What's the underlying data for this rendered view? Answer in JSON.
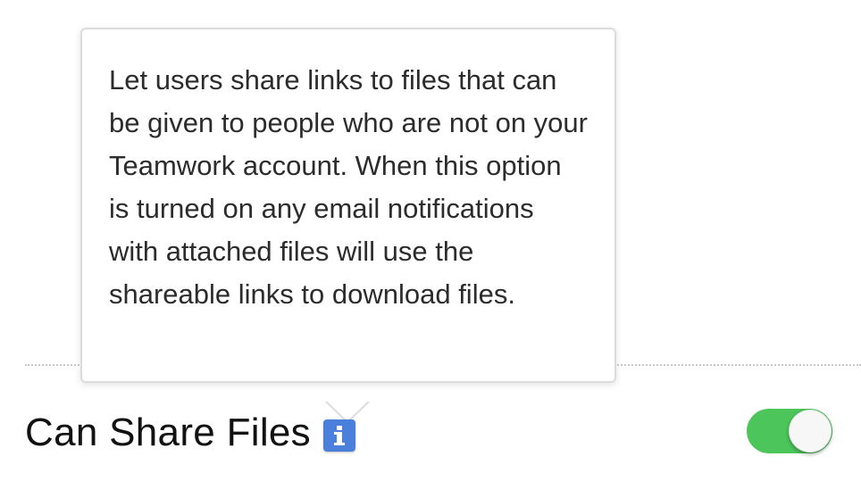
{
  "tooltip": {
    "text": "Let users share links to files that can be given to people who are not on your Teamwork account. When this option is turned on any email notifications with attached files will use the shareable links to download files."
  },
  "setting": {
    "label": "Can Share Files",
    "info_icon": "info-icon",
    "toggle_state": "on"
  },
  "colors": {
    "toggle_on": "#4cc55a",
    "info_icon": "#4a7fdc"
  }
}
